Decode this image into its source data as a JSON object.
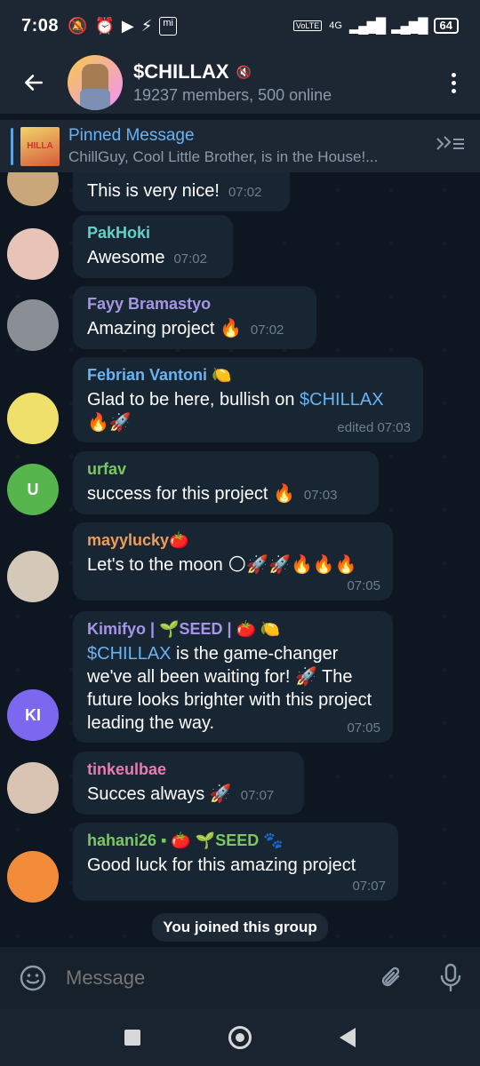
{
  "status_bar": {
    "time": "7:08",
    "icons": [
      "🔕",
      "⏰",
      "▶",
      "⚡",
      "mi"
    ],
    "network": "4G",
    "volte": "VoLTE",
    "battery": "64"
  },
  "header": {
    "title": "$CHILLAX",
    "subtitle": "19237 members, 500 online",
    "back_icon": "arrow-left",
    "menu_icon": "more-vertical"
  },
  "pinned": {
    "title": "Pinned Message",
    "preview": "ChillGuy, Cool Little Brother, is in the House!...",
    "thumb_text": "HILLA"
  },
  "messages": [
    {
      "sender": "",
      "text": "This is very nice!",
      "time": "07:02",
      "avatar_initials": "",
      "avatar_color": "#c9a77a"
    },
    {
      "sender": "PakHoki",
      "sender_color": "#5fd4c6",
      "text": "Awesome",
      "time": "07:02",
      "avatar_initials": "",
      "avatar_color": "#e8c4b8"
    },
    {
      "sender": "Fayy Bramastyo",
      "sender_color": "#a695e7",
      "text": "Amazing project 🔥",
      "time": "07:02",
      "avatar_initials": "",
      "avatar_color": "#8a8f96"
    },
    {
      "sender": "Febrian Vantoni 🍋",
      "sender_color": "#6ab3f3",
      "text_prefix": "Glad to be here, bullish on ",
      "text_link": "$CHILLAX",
      "text_suffix": "🔥🚀",
      "time": "edited 07:03",
      "avatar_initials": "",
      "avatar_color": "#eee06a"
    },
    {
      "sender": "urfav",
      "sender_color": "#7bc862",
      "text": "success for this project 🔥",
      "time": "07:03",
      "avatar_initials": "U",
      "avatar_color": "#56b54d"
    },
    {
      "sender": "mayylucky🍅",
      "sender_color": "#ee9d5a",
      "text": "Let's to the moon 🌕🚀🚀🔥🔥🔥",
      "time": "07:05",
      "avatar_initials": "",
      "avatar_color": "#d4c9b8"
    },
    {
      "sender": "Kimifyo | 🌱SEED | 🍅 🍋",
      "sender_color": "#a695e7",
      "text_link": "$CHILLAX",
      "text_suffix": " is the game-changer we've all been waiting for! 🚀 The future looks brighter with this project leading the way.",
      "time": "07:05",
      "avatar_initials": "KI",
      "avatar_color": "#7b68ee"
    },
    {
      "sender": "tinkeulbae",
      "sender_color": "#ee7aae",
      "text": "Succes always 🚀",
      "time": "07:07",
      "avatar_initials": "",
      "avatar_color": "#d9c4b4"
    },
    {
      "sender": "hahani26 ▪ 🍅 🌱SEED 🐾",
      "sender_color": "#7bc862",
      "text": "Good luck for this amazing project",
      "time": "07:07",
      "avatar_initials": "",
      "avatar_color": "#f28c3b"
    }
  ],
  "service_message": "You joined this group",
  "composer": {
    "placeholder": "Message"
  },
  "colors": {
    "bg": "#0e1621",
    "bubble": "#182533",
    "accent": "#6ab3f3"
  }
}
